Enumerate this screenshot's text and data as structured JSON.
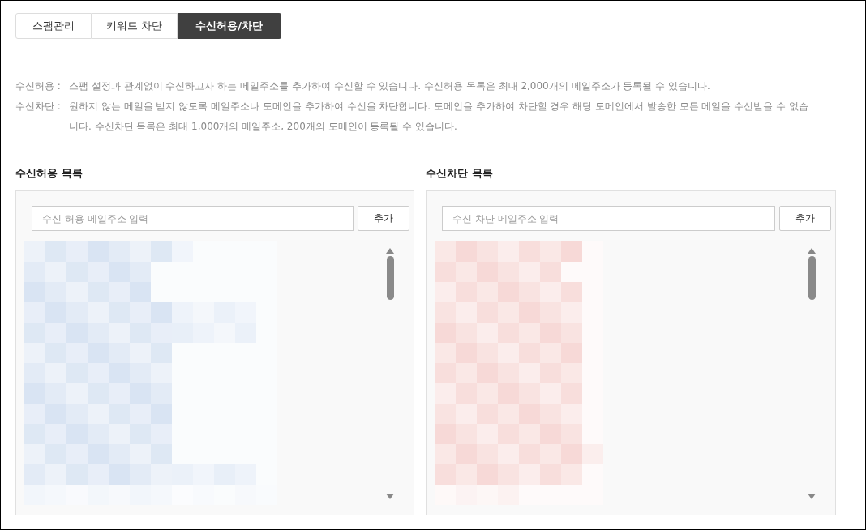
{
  "tabs": [
    {
      "label": "스팸관리",
      "selected": false
    },
    {
      "label": "키워드 차단",
      "selected": false
    },
    {
      "label": "수신허용/차단",
      "selected": true
    }
  ],
  "descriptions": [
    {
      "label": "수신허용 :",
      "text": "스팸 설정과 관계없이 수신하고자 하는 메일주소를 추가하여 수신할 수 있습니다. 수신허용 목록은 최대 2,000개의 메일주소가 등록될 수 있습니다."
    },
    {
      "label": "수신차단 :",
      "text": "원하지 않는 메일을 받지 않도록 메일주소나 도메인을 추가하여 수신을 차단합니다. 도메인을 추가하여 차단할 경우 해당 도메인에서 발송한 모든 메일을 수신받을 수 없습니다. 수신차단 목록은 최대 1,000개의 메일주소, 200개의 도메인이 등록될 수 있습니다."
    }
  ],
  "lists": [
    {
      "title": "수신허용 목록",
      "input": {
        "placeholder": "수신 허용 메일주소 입력"
      },
      "button": "추가"
    },
    {
      "title": "수신차단 목록",
      "input": {
        "placeholder": "수신 차단 메일주소 입력"
      },
      "button": "추가"
    }
  ]
}
